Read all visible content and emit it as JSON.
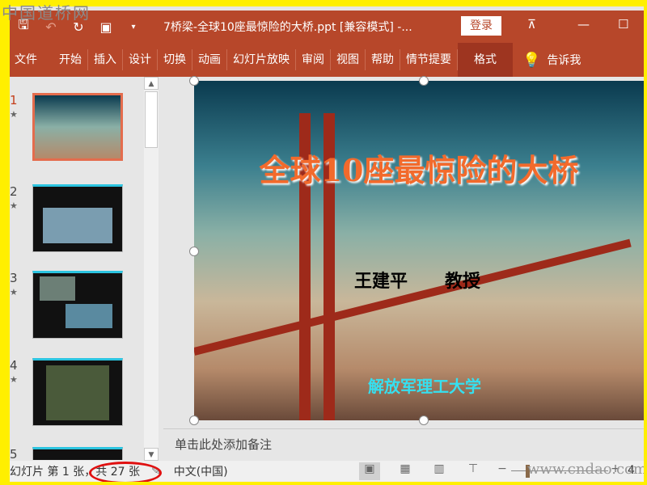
{
  "watermark": "中国道桥网",
  "watermark_url": "www.cndao.com",
  "titlebar": {
    "title": "7桥梁-全球10座最惊险的大桥.ppt [兼容模式]  -...",
    "login": "登录"
  },
  "ribbon": {
    "tabs": [
      "文件",
      "开始",
      "插入",
      "设计",
      "切换",
      "动画",
      "幻灯片放映",
      "审阅",
      "视图",
      "帮助",
      "情节提要",
      "格式"
    ],
    "tell_me": "告诉我"
  },
  "thumbnails": [
    {
      "num": "1"
    },
    {
      "num": "2"
    },
    {
      "num": "3"
    },
    {
      "num": "4"
    },
    {
      "num": "5"
    }
  ],
  "slide": {
    "title": "全球10座最惊险的大桥",
    "author": "王建平",
    "role": "教授",
    "org": "解放军理工大学"
  },
  "notes_placeholder": "单击此处添加备注",
  "status": {
    "slide_info": "幻灯片 第 1 张，共 27 张",
    "language": "中文(中国)",
    "zoom": "4"
  }
}
